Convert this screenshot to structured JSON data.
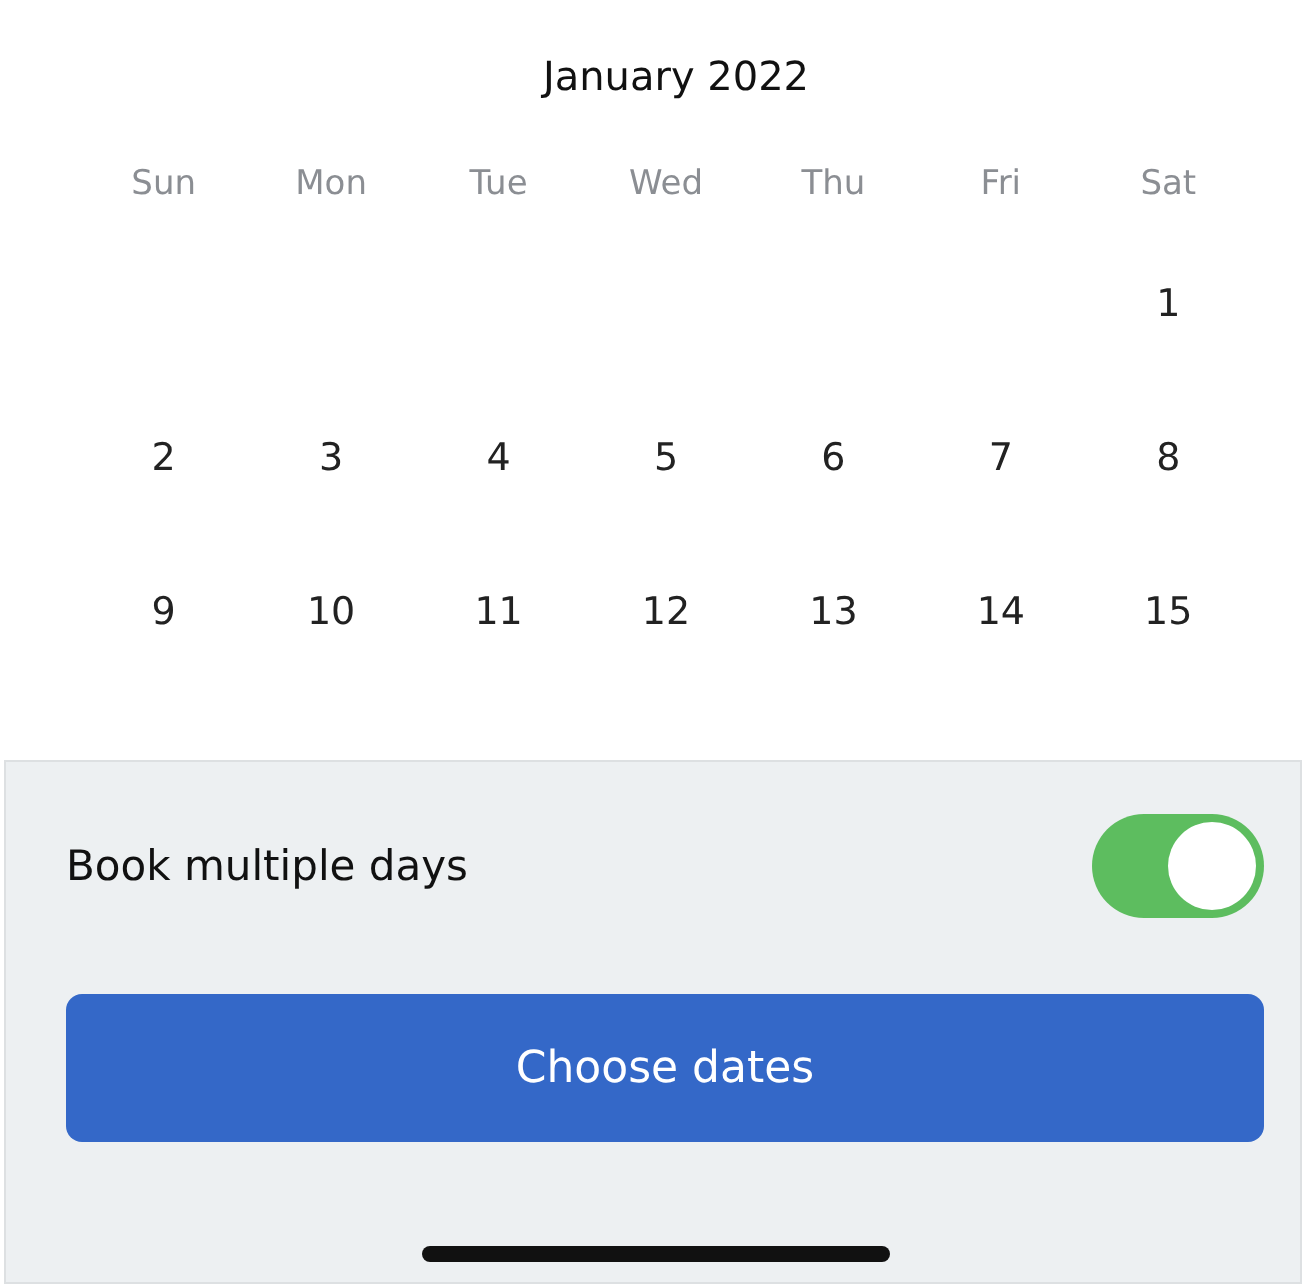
{
  "calendar": {
    "title": "January 2022",
    "weekdays": [
      "Sun",
      "Mon",
      "Tue",
      "Wed",
      "Thu",
      "Fri",
      "Sat"
    ],
    "weeks": [
      {
        "kind": "first",
        "days": [
          "1"
        ]
      },
      {
        "kind": "full",
        "days": [
          "2",
          "3",
          "4",
          "5",
          "6",
          "7",
          "8"
        ]
      },
      {
        "kind": "full",
        "days": [
          "9",
          "10",
          "11",
          "12",
          "13",
          "14",
          "15"
        ]
      }
    ]
  },
  "options": {
    "label": "Book multiple days",
    "on": true
  },
  "primary_button": {
    "label": "Choose dates"
  }
}
